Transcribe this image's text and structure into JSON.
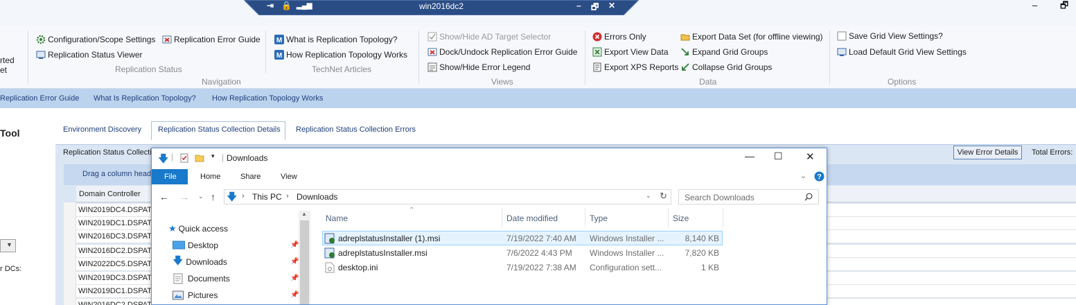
{
  "remote_bar": {
    "title": "win2016dc2"
  },
  "ribbon": {
    "left_partial_text": [
      "rted",
      "et"
    ],
    "replication_status": {
      "label": "Replication Status",
      "items": [
        "Configuration/Scope Settings",
        "Replication Status Viewer"
      ]
    },
    "replication_error_guide": "Replication Error Guide",
    "navigation_label": "Navigation",
    "technet": {
      "label": "TechNet Articles",
      "items": [
        "What is Replication Topology?",
        "How Replication Topology Works"
      ]
    },
    "views": {
      "label": "Views",
      "items": [
        "Show/Hide AD Target Selector",
        "Dock/Undock Replication Error Guide",
        "Show/Hide Error Legend"
      ]
    },
    "data": {
      "label": "Data",
      "left_items": [
        "Errors Only",
        "Export View Data",
        "Export XPS Reports"
      ],
      "right_items": [
        "Export Data Set (for offline viewing)",
        "Expand Grid Groups",
        "Collapse Grid Groups"
      ]
    },
    "options": {
      "label": "Options",
      "items": [
        "Save Grid View Settings?",
        "Load Default Grid View Settings"
      ]
    }
  },
  "link_bar": [
    "Replication Error Guide",
    "What Is Replication Topology?",
    "How Replication Topology Works"
  ],
  "left_panel": {
    "tool_label": "Tool",
    "dcs_label": "r DCs:"
  },
  "tabs": [
    "Environment Discovery",
    "Replication Status Collection Details",
    "Replication Status Collection Errors"
  ],
  "grid": {
    "panel_title": "Replication Status Collecti",
    "drag_hint": "Drag a column head",
    "column_header": "Domain Controller",
    "rows": [
      "WIN2019DC4.DSPATI",
      "WIN2019DC1.DSPATI",
      "WIN2016DC3.DSPATI",
      "WIN2016DC2.DSPATI",
      "WIN2022DC5.DSPATI",
      "WIN2019DC3.DSPATI",
      "WIN2019DC1.DSPATI",
      "WIN2016DC2.DSPATI"
    ],
    "view_error_details": "View Error Details",
    "total_errors": "Total Errors:"
  },
  "explorer": {
    "title": "Downloads",
    "ribbon_tabs": [
      "File",
      "Home",
      "Share",
      "View"
    ],
    "path": [
      "This PC",
      "Downloads"
    ],
    "search_placeholder": "Search Downloads",
    "nav": [
      {
        "label": "Quick access",
        "icon": "star-icon"
      },
      {
        "label": "Desktop",
        "icon": "desktop-folder-icon"
      },
      {
        "label": "Downloads",
        "icon": "download-arrow-icon"
      },
      {
        "label": "Documents",
        "icon": "documents-icon"
      },
      {
        "label": "Pictures",
        "icon": "pictures-icon"
      }
    ],
    "columns": [
      "Name",
      "Date modified",
      "Type",
      "Size"
    ],
    "files": [
      {
        "name": "adreplstatusInstaller (1).msi",
        "date": "7/19/2022 7:40 AM",
        "type": "Windows Installer ...",
        "size": "8,140 KB"
      },
      {
        "name": "adreplstatusInstaller.msi",
        "date": "7/6/2022 4:43 PM",
        "type": "Windows Installer ...",
        "size": "7,820 KB"
      },
      {
        "name": "desktop.ini",
        "date": "7/19/2022 7:38 AM",
        "type": "Configuration sett...",
        "size": "1 KB"
      }
    ]
  },
  "colors": {
    "accent": "#1979ca",
    "ribbon_bg": "#f6f8fc",
    "link_bar": "#bcd3ee",
    "rd_bar": "#2a4d86"
  }
}
